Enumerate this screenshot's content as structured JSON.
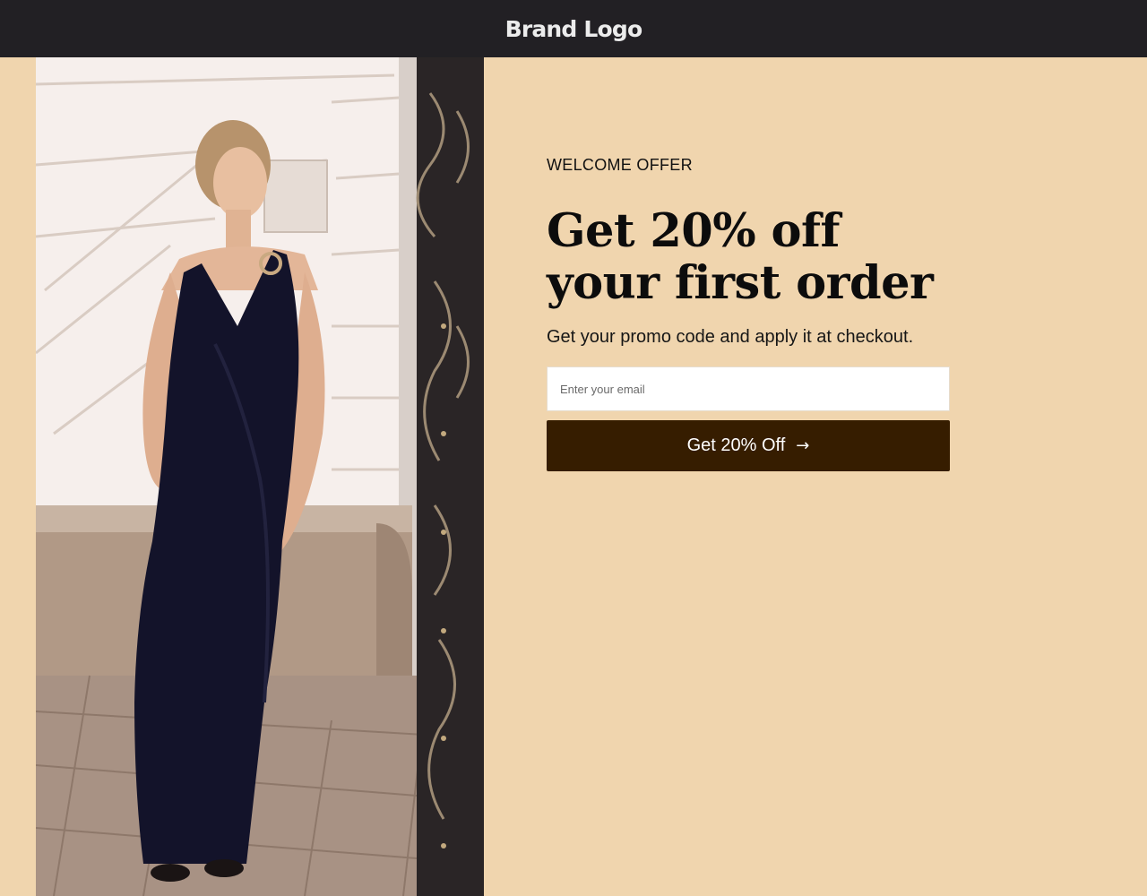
{
  "header": {
    "logo_text": "Brand Logo"
  },
  "hero_image": {
    "alt": "Woman in a long navy dress standing by a cream building",
    "icon": "photo-model-dress"
  },
  "offer": {
    "eyebrow": "WELCOME OFFER",
    "headline_line1": "Get 20% off",
    "headline_line2": "your first order",
    "subline": "Get your promo code and apply it at checkout.",
    "email_placeholder": "Enter your email",
    "email_value": "",
    "cta_label": "Get 20% Off",
    "cta_arrow": "→"
  },
  "colors": {
    "topbar": "#222024",
    "background": "#f0d5ae",
    "cta": "#361d00",
    "cta_text": "#ffffff"
  }
}
